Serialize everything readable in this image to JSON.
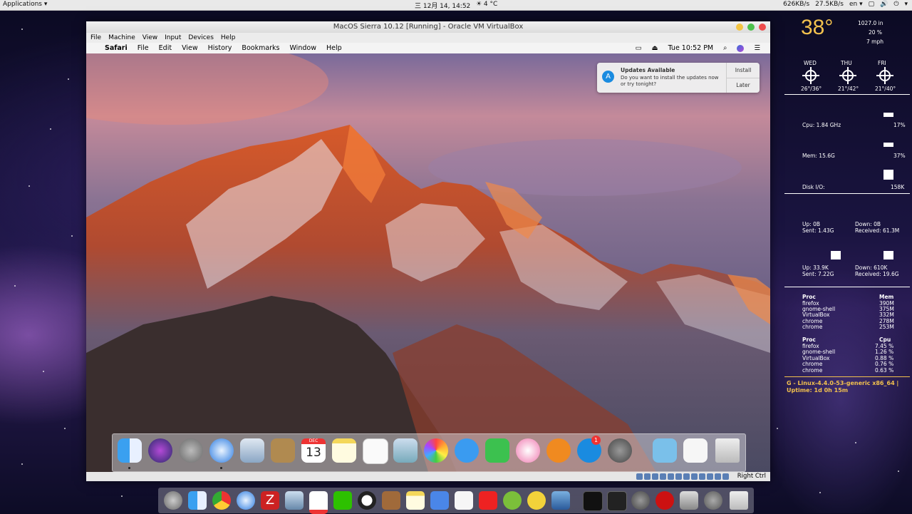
{
  "topbar": {
    "applications": "Applications ▾",
    "clock": "三 12月 14, 14:52",
    "weather": "☀ 4 °C",
    "net_down": "626KB/s",
    "net_up": "27.5KB/s",
    "lang": "en ▾"
  },
  "vbox": {
    "title": "MacOS Sierra 10.12 [Running] - Oracle VM VirtualBox",
    "menu": [
      "File",
      "Machine",
      "View",
      "Input",
      "Devices",
      "Help"
    ],
    "status_right": "Right Ctrl"
  },
  "macmenu": {
    "apple": "",
    "app": "Safari",
    "items": [
      "File",
      "Edit",
      "View",
      "History",
      "Bookmarks",
      "Window",
      "Help"
    ],
    "time": "Tue 10:52 PM"
  },
  "notification": {
    "title": "Updates Available",
    "text": "Do you want to install the updates now or try tonight?",
    "install": "Install",
    "later": "Later"
  },
  "macdock": {
    "calendar_month": "DEC",
    "calendar_day": "13",
    "appstore_badge": "1",
    "apps": [
      "finder",
      "siri",
      "launchpad",
      "safari",
      "mail",
      "contacts",
      "calendar",
      "notes",
      "reminders",
      "preview",
      "photos",
      "messages",
      "facetime",
      "itunes",
      "ibooks",
      "app-store",
      "system-preferences",
      "downloads",
      "document",
      "trash"
    ]
  },
  "conky": {
    "temp": "38°",
    "pressure": "1027.0 in",
    "humidity": "20 %",
    "wind": "7 mph",
    "days": [
      {
        "name": "WED",
        "range": "26°/36°"
      },
      {
        "name": "THU",
        "range": "21°/42°"
      },
      {
        "name": "FRI",
        "range": "21°/40°"
      }
    ],
    "cpu_label": "Cpu: 1.84 GHz",
    "cpu_pct": "17%",
    "mem_label": "Mem: 15.6G",
    "mem_pct": "37%",
    "disk_label": "Disk I/O:",
    "disk_val": "158K",
    "net1": {
      "up": "Up: 0B",
      "down": "Down: 0B",
      "sent": "Sent: 1.43G",
      "received": "Received: 61.3M"
    },
    "net2": {
      "up": "Up: 33.9K",
      "down": "Down: 610K",
      "sent": "Sent: 7.22G",
      "received": "Received: 19.6G"
    },
    "proc_mem": {
      "header": "Proc",
      "col": "Mem",
      "rows": [
        {
          "name": "firefox",
          "val": "390M"
        },
        {
          "name": "gnome-shell",
          "val": "375M"
        },
        {
          "name": "VirtualBox",
          "val": "332M"
        },
        {
          "name": "chrome",
          "val": "278M"
        },
        {
          "name": "chrome",
          "val": "253M"
        }
      ]
    },
    "proc_cpu": {
      "header": "Proc",
      "col": "Cpu",
      "rows": [
        {
          "name": "firefox",
          "val": "7.45 %"
        },
        {
          "name": "gnome-shell",
          "val": "1.26 %"
        },
        {
          "name": "VirtualBox",
          "val": "0.88 %"
        },
        {
          "name": "chrome",
          "val": "0.76 %"
        },
        {
          "name": "chrome",
          "val": "0.63 %"
        }
      ]
    },
    "kernel": "G - Linux-4.4.0-53-generic x86_64 |",
    "uptime": "Uptime: 1d 0h 15m"
  }
}
